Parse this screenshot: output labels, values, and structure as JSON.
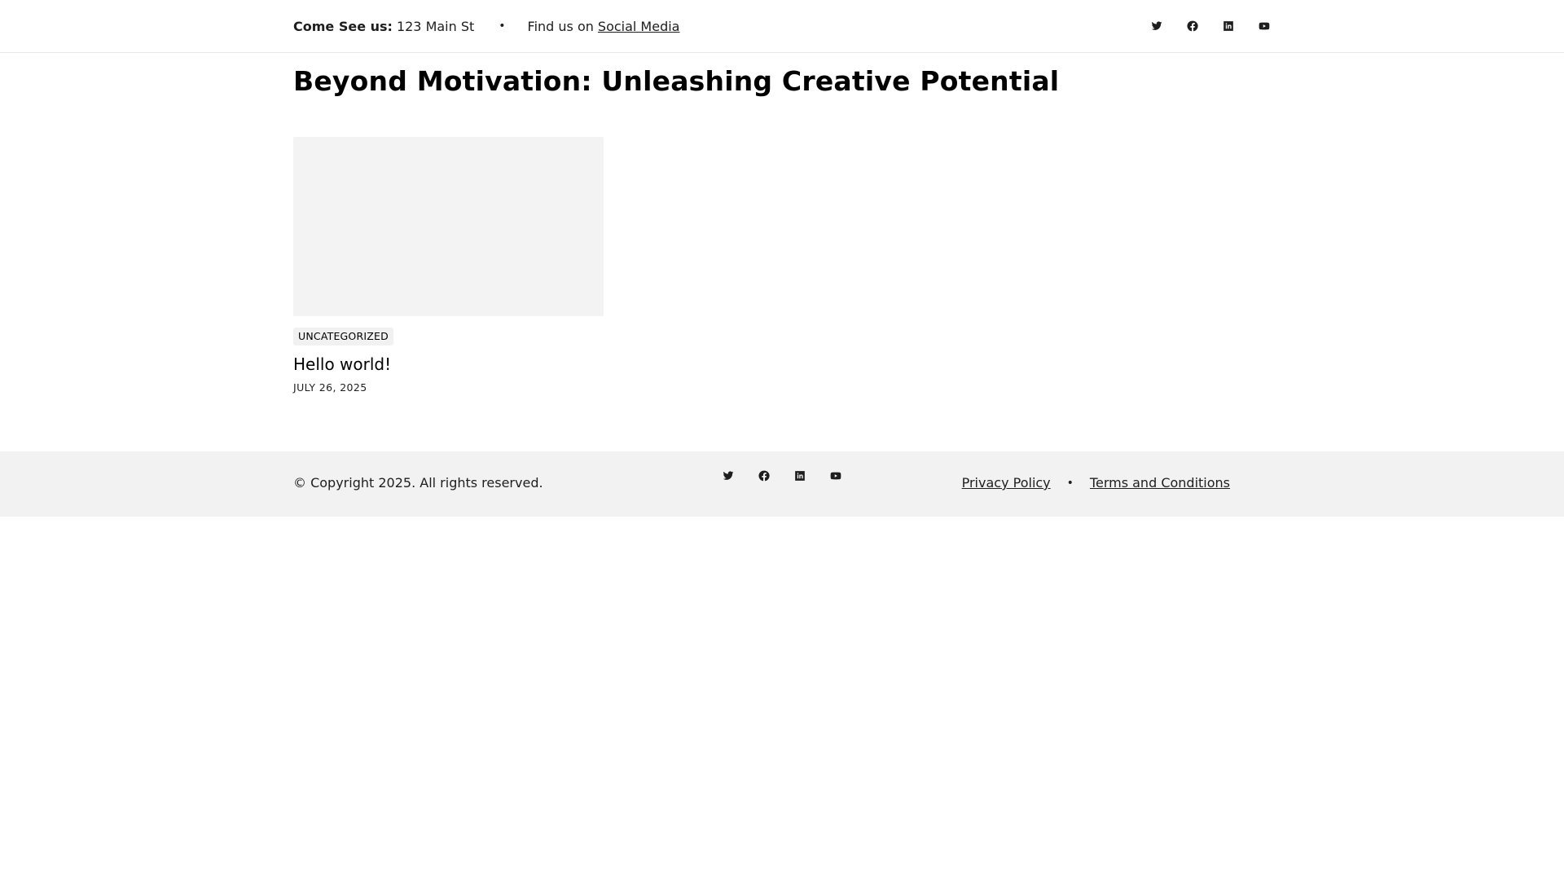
{
  "topbar": {
    "address_label": "Come See us:",
    "address_value": "123 Main St",
    "separator": "•",
    "social_prefix": "Find us on",
    "social_link": "Social Media",
    "icons": [
      "twitter-icon",
      "facebook-icon",
      "linkedin-icon",
      "youtube-icon"
    ]
  },
  "main": {
    "page_title": "Beyond Motivation: Unleashing Creative Potential",
    "posts": [
      {
        "category": "UNCATEGORIZED",
        "title": "Hello world!",
        "date": "JULY 26, 2025"
      }
    ]
  },
  "footer": {
    "copyright": "© Copyright 2025. All rights reserved.",
    "icons": [
      "twitter-icon",
      "facebook-icon",
      "linkedin-icon",
      "youtube-icon"
    ],
    "links": [
      "Privacy Policy",
      "Terms and Conditions"
    ],
    "separator": "•",
    "background": "#f2f2f2"
  }
}
